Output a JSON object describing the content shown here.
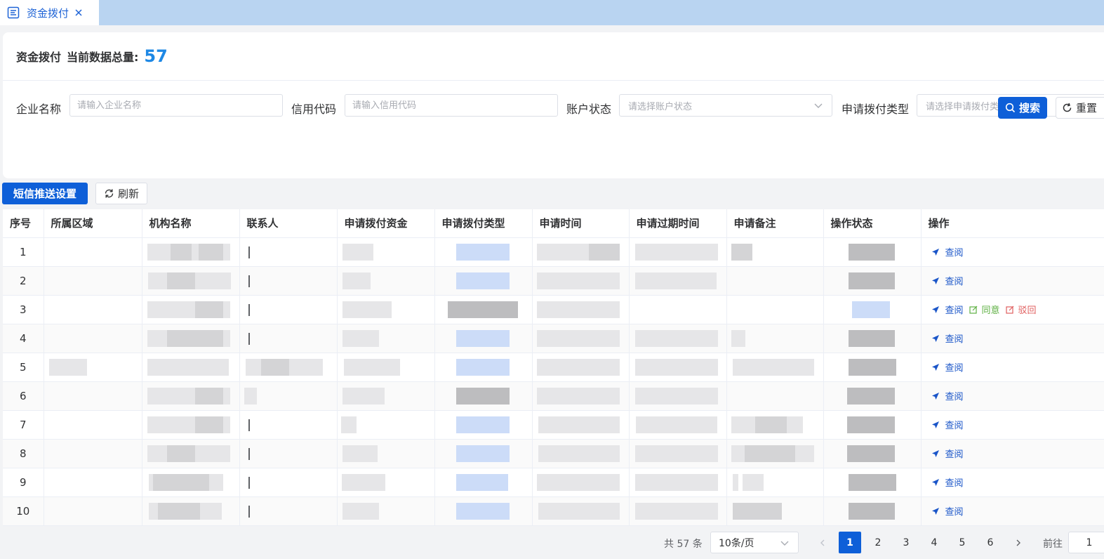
{
  "tab": {
    "icon": "list-doc-icon",
    "title": "资金拨付"
  },
  "header": {
    "title": "资金拨付",
    "total_label": "当前数据总量:",
    "total_count": "57"
  },
  "filters": {
    "company_name": {
      "label": "企业名称",
      "placeholder": "请输入企业名称"
    },
    "credit_code": {
      "label": "信用代码",
      "placeholder": "请输入信用代码"
    },
    "account_status": {
      "label": "账户状态",
      "placeholder": "请选择账户状态"
    },
    "apply_type": {
      "label": "申请拨付类型",
      "placeholder": "请选择申请拨付类型"
    },
    "search_label": "搜索",
    "reset_label": "重置"
  },
  "toolbar": {
    "sms_label": "短信推送设置",
    "refresh_label": "刷新"
  },
  "table": {
    "columns": [
      "序号",
      "所属区域",
      "机构名称",
      "联系人",
      "申请拨付资金",
      "申请拨付类型",
      "申请时间",
      "申请过期时间",
      "申请备注",
      "操作状态",
      "操作"
    ],
    "rows": [
      {
        "index": "1"
      },
      {
        "index": "2"
      },
      {
        "index": "3"
      },
      {
        "index": "4"
      },
      {
        "index": "5"
      },
      {
        "index": "6"
      },
      {
        "index": "7"
      },
      {
        "index": "8"
      },
      {
        "index": "9"
      },
      {
        "index": "10"
      }
    ],
    "actions": {
      "view": "查阅",
      "agree": "同意",
      "reject": "驳回"
    },
    "note": "Cell contents other than 序号 are blurred/redacted in the screenshot"
  },
  "pagination": {
    "total_text": "共 57 条",
    "page_size": "10条/页",
    "pages": [
      "1",
      "2",
      "3",
      "4",
      "5",
      "6"
    ],
    "current_page": "1",
    "goto_label": "前往",
    "goto_value": "1"
  },
  "colors": {
    "primary": "#0e5fd8",
    "accent_count": "#1e88e5",
    "tabbar": "#b9d4f1",
    "agree": "#5eb042",
    "reject": "#e05f5f"
  }
}
